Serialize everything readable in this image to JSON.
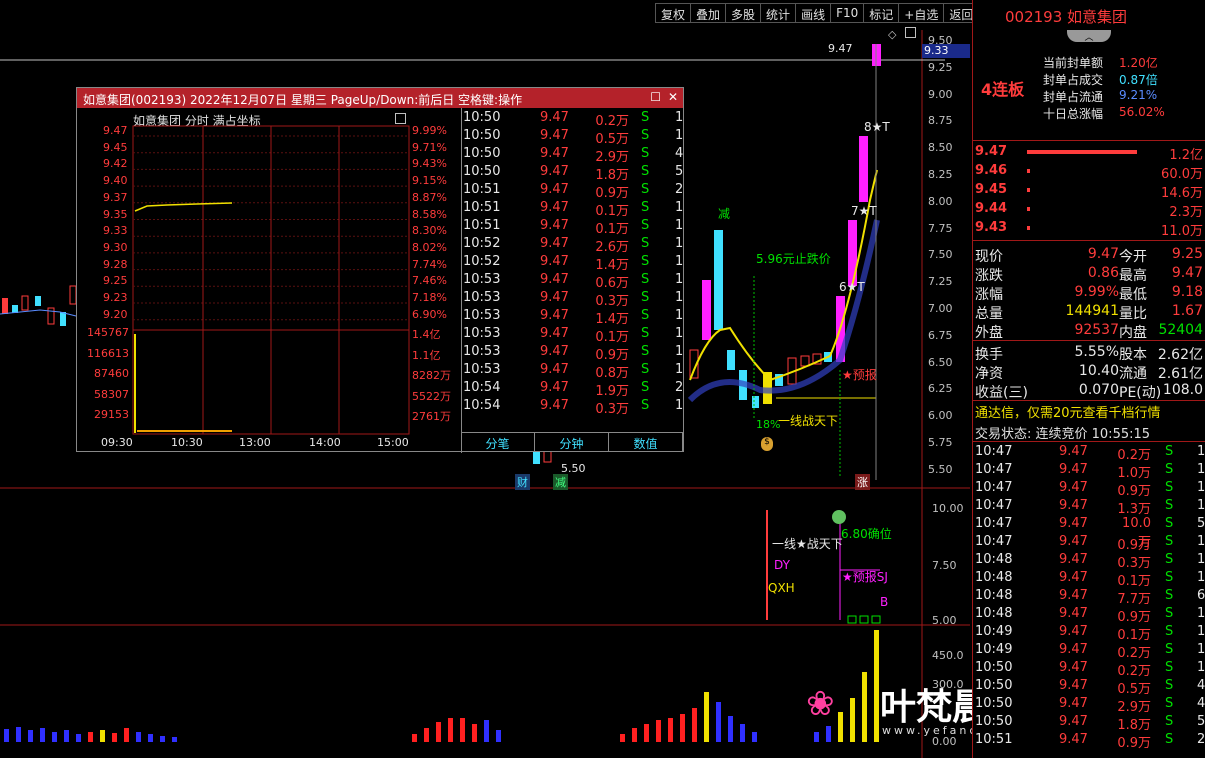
{
  "toolbar": {
    "items": [
      "复权",
      "叠加",
      "多股",
      "统计",
      "画线",
      "F10",
      "标记",
      "+自选",
      "返回"
    ]
  },
  "main_axis": {
    "labels": [
      "9.50",
      "9.25",
      "9.00",
      "8.75",
      "8.50",
      "8.25",
      "8.00",
      "7.75",
      "7.50",
      "7.25",
      "7.00",
      "6.75",
      "6.50",
      "6.25",
      "6.00",
      "5.75",
      "5.50"
    ],
    "current_price": "9.33"
  },
  "mid_axis": {
    "labels": [
      "10.00",
      "7.50",
      "5.00"
    ]
  },
  "vol_axis": {
    "labels": [
      "450.0",
      "300.0",
      "0.00"
    ]
  },
  "chart_labels": {
    "high_price": "9.47",
    "low_price": "5.50",
    "stop_loss": "5.96元止跌价",
    "jian_top": "减",
    "line_war": "一线战天下",
    "pct18": "18%",
    "pred": "★预报",
    "star6": "6★T",
    "star7": "7★T",
    "star8": "8★T",
    "cai": "财",
    "jian": "减",
    "zhang": "涨",
    "ind_line_war": "一线★战天下",
    "dy": "DY",
    "qxh": "QXH",
    "ind_price": "6.80确位",
    "ind_pred": "★预报SJ",
    "ind_b": "B"
  },
  "popup": {
    "title": "如意集团(002193) 2022年12月07日 星期三 PageUp/Down:前后日 空格键:操作",
    "subtitle": "如意集团  分时 满占坐标",
    "price_labels": [
      "9.47",
      "9.45",
      "9.42",
      "9.40",
      "9.37",
      "9.35",
      "9.33",
      "9.30",
      "9.28",
      "9.25",
      "9.23",
      "9.20"
    ],
    "vol_labels": [
      "145767",
      "116613",
      "87460",
      "58307",
      "29153"
    ],
    "pct_labels": [
      "9.99%",
      "9.71%",
      "9.43%",
      "9.15%",
      "8.87%",
      "8.58%",
      "8.30%",
      "8.02%",
      "7.74%",
      "7.46%",
      "7.18%",
      "6.90%"
    ],
    "amt_labels": [
      "1.4亿",
      "1.1亿",
      "8282万",
      "5522万",
      "2761万"
    ],
    "time_labels": [
      "09:30",
      "10:30",
      "13:00",
      "14:00",
      "15:00"
    ],
    "trades": [
      [
        "10:50",
        "9.47",
        "0.2万",
        "S",
        "1"
      ],
      [
        "10:50",
        "9.47",
        "0.5万",
        "S",
        "1"
      ],
      [
        "10:50",
        "9.47",
        "2.9万",
        "S",
        "4"
      ],
      [
        "10:50",
        "9.47",
        "1.8万",
        "S",
        "5"
      ],
      [
        "10:51",
        "9.47",
        "0.9万",
        "S",
        "2"
      ],
      [
        "10:51",
        "9.47",
        "0.1万",
        "S",
        "1"
      ],
      [
        "10:51",
        "9.47",
        "0.1万",
        "S",
        "1"
      ],
      [
        "10:52",
        "9.47",
        "2.6万",
        "S",
        "1"
      ],
      [
        "10:52",
        "9.47",
        "1.4万",
        "S",
        "1"
      ],
      [
        "10:53",
        "9.47",
        "0.6万",
        "S",
        "1"
      ],
      [
        "10:53",
        "9.47",
        "0.3万",
        "S",
        "1"
      ],
      [
        "10:53",
        "9.47",
        "1.4万",
        "S",
        "1"
      ],
      [
        "10:53",
        "9.47",
        "0.1万",
        "S",
        "1"
      ],
      [
        "10:53",
        "9.47",
        "0.9万",
        "S",
        "1"
      ],
      [
        "10:53",
        "9.47",
        "0.8万",
        "S",
        "1"
      ],
      [
        "10:54",
        "9.47",
        "1.9万",
        "S",
        "2"
      ],
      [
        "10:54",
        "9.47",
        "0.3万",
        "S",
        "1"
      ]
    ],
    "tabs": [
      "分笔",
      "分钟",
      "数值"
    ]
  },
  "right": {
    "code_name": "002193 如意集团",
    "seal": [
      [
        "当前封单额",
        "1.20亿"
      ],
      [
        "封单占成交",
        "0.87倍"
      ],
      [
        "封单占流通",
        "9.21%"
      ],
      [
        "十日总涨幅",
        "56.02%"
      ]
    ],
    "streak": "4连板",
    "bids": [
      [
        "9.47",
        "1.2亿"
      ],
      [
        "9.46",
        "60.0万"
      ],
      [
        "9.45",
        "14.6万"
      ],
      [
        "9.44",
        "2.3万"
      ],
      [
        "9.43",
        "11.0万"
      ]
    ],
    "stats": [
      [
        "现价",
        "9.47",
        "今开",
        "9.25"
      ],
      [
        "涨跌",
        "0.86",
        "最高",
        "9.47"
      ],
      [
        "涨幅",
        "9.99%",
        "最低",
        "9.18"
      ],
      [
        "总量",
        "144941",
        "量比",
        "1.67"
      ],
      [
        "外盘",
        "92537",
        "内盘",
        "52404"
      ]
    ],
    "stats2": [
      [
        "换手",
        "5.55%",
        "股本",
        "2.62亿"
      ],
      [
        "净资",
        "10.40",
        "流通",
        "2.61亿"
      ],
      [
        "收益(三)",
        "0.070",
        "PE(动)",
        "108.0"
      ]
    ],
    "ad": "通达信，仅需20元查看千档行情",
    "status": "交易状态: 连续竞价 10:55:15",
    "trades": [
      [
        "10:47",
        "9.47",
        "0.2万",
        "S",
        "1"
      ],
      [
        "10:47",
        "9.47",
        "1.0万",
        "S",
        "1"
      ],
      [
        "10:47",
        "9.47",
        "0.9万",
        "S",
        "1"
      ],
      [
        "10:47",
        "9.47",
        "1.3万",
        "S",
        "1"
      ],
      [
        "10:47",
        "9.47",
        "10.0万",
        "S",
        "5"
      ],
      [
        "10:47",
        "9.47",
        "0.9万",
        "S",
        "1"
      ],
      [
        "10:48",
        "9.47",
        "0.3万",
        "S",
        "1"
      ],
      [
        "10:48",
        "9.47",
        "0.1万",
        "S",
        "1"
      ],
      [
        "10:48",
        "9.47",
        "7.7万",
        "S",
        "6"
      ],
      [
        "10:48",
        "9.47",
        "0.9万",
        "S",
        "1"
      ],
      [
        "10:49",
        "9.47",
        "0.1万",
        "S",
        "1"
      ],
      [
        "10:49",
        "9.47",
        "0.2万",
        "S",
        "1"
      ],
      [
        "10:50",
        "9.47",
        "0.2万",
        "S",
        "1"
      ],
      [
        "10:50",
        "9.47",
        "0.5万",
        "S",
        "4"
      ],
      [
        "10:50",
        "9.47",
        "2.9万",
        "S",
        "4"
      ],
      [
        "10:50",
        "9.47",
        "1.8万",
        "S",
        "5"
      ],
      [
        "10:51",
        "9.47",
        "0.9万",
        "S",
        "2"
      ]
    ]
  },
  "watermark": {
    "title": "叶梵晨指标公式网",
    "url": "www.yefanchen.com 指标公式网"
  }
}
